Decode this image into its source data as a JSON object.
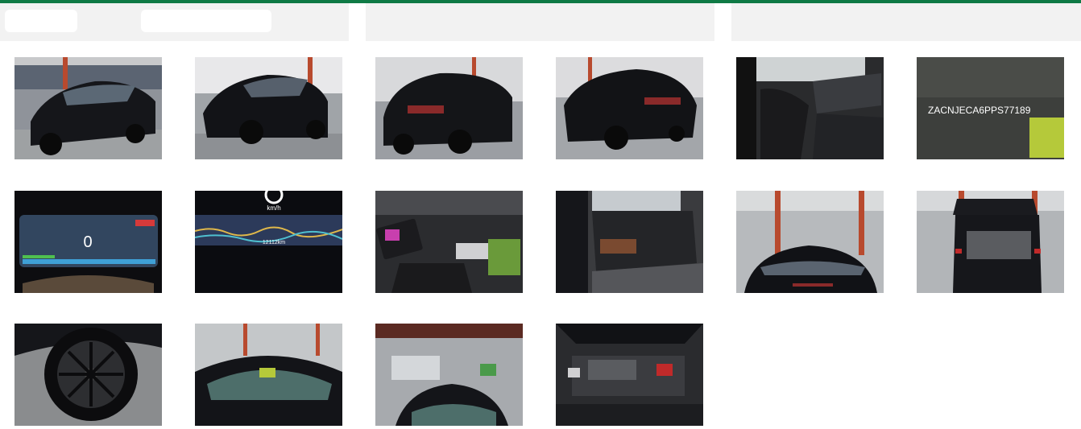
{
  "header": {
    "accent_color": "#0f7a45",
    "tabs": [
      "",
      "",
      ""
    ]
  },
  "gallery": {
    "photos": [
      {
        "id": "exterior-front-left",
        "icon": "car-front-icon"
      },
      {
        "id": "exterior-front-right",
        "icon": "car-front-icon"
      },
      {
        "id": "exterior-rear-left",
        "icon": "car-rear-icon"
      },
      {
        "id": "exterior-rear-right",
        "icon": "car-rear-icon"
      },
      {
        "id": "interior-front-seats",
        "icon": "seat-icon"
      },
      {
        "id": "vin-plate",
        "icon": "vin-icon",
        "text": "ZACNJECA6PPS77189"
      },
      {
        "id": "instrument-cluster",
        "icon": "dashboard-icon",
        "speed": "0"
      },
      {
        "id": "odometer",
        "icon": "odometer-icon",
        "unit": "km/h",
        "reading": "12112km"
      },
      {
        "id": "center-console",
        "icon": "console-icon"
      },
      {
        "id": "rear-seats",
        "icon": "seat-icon"
      },
      {
        "id": "roof-view",
        "icon": "roof-icon"
      },
      {
        "id": "open-tailgate",
        "icon": "trunk-icon"
      },
      {
        "id": "wheel",
        "icon": "wheel-icon"
      },
      {
        "id": "windshield",
        "icon": "windshield-icon"
      },
      {
        "id": "roof-rear-view",
        "icon": "roof-icon"
      },
      {
        "id": "engine-bay",
        "icon": "engine-icon"
      }
    ]
  }
}
